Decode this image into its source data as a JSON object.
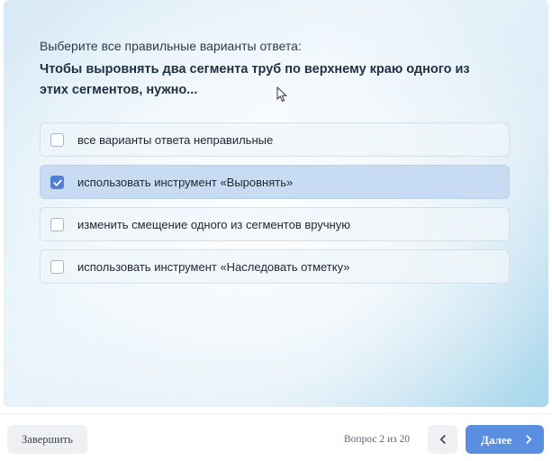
{
  "quiz": {
    "instruction": "Выберите все правильные варианты ответа:",
    "question": "Чтобы выровнять два сегмента труб по верхнему краю одного из этих сегментов, нужно...",
    "options": [
      {
        "label": "все варианты ответа неправильные",
        "checked": false
      },
      {
        "label": "использовать инструмент «Выровнять»",
        "checked": true
      },
      {
        "label": "изменить смещение одного из сегментов вручную",
        "checked": false
      },
      {
        "label": "использовать инструмент «Наследовать отметку»",
        "checked": false
      }
    ]
  },
  "footer": {
    "finish_label": "Завершить",
    "progress": "Вопрос 2 из 20",
    "current_question": 2,
    "total_questions": 20,
    "next_label": "Далее"
  },
  "colors": {
    "accent": "#5a8ee0",
    "checkbox_checked": "#4f7fd9",
    "selected_option_bg": "#c7dcf2"
  },
  "icons": {
    "checkbox_checked": "check-icon",
    "cursor": "mouse-pointer-icon",
    "prev": "chevron-left-icon",
    "next": "chevron-right-icon"
  }
}
